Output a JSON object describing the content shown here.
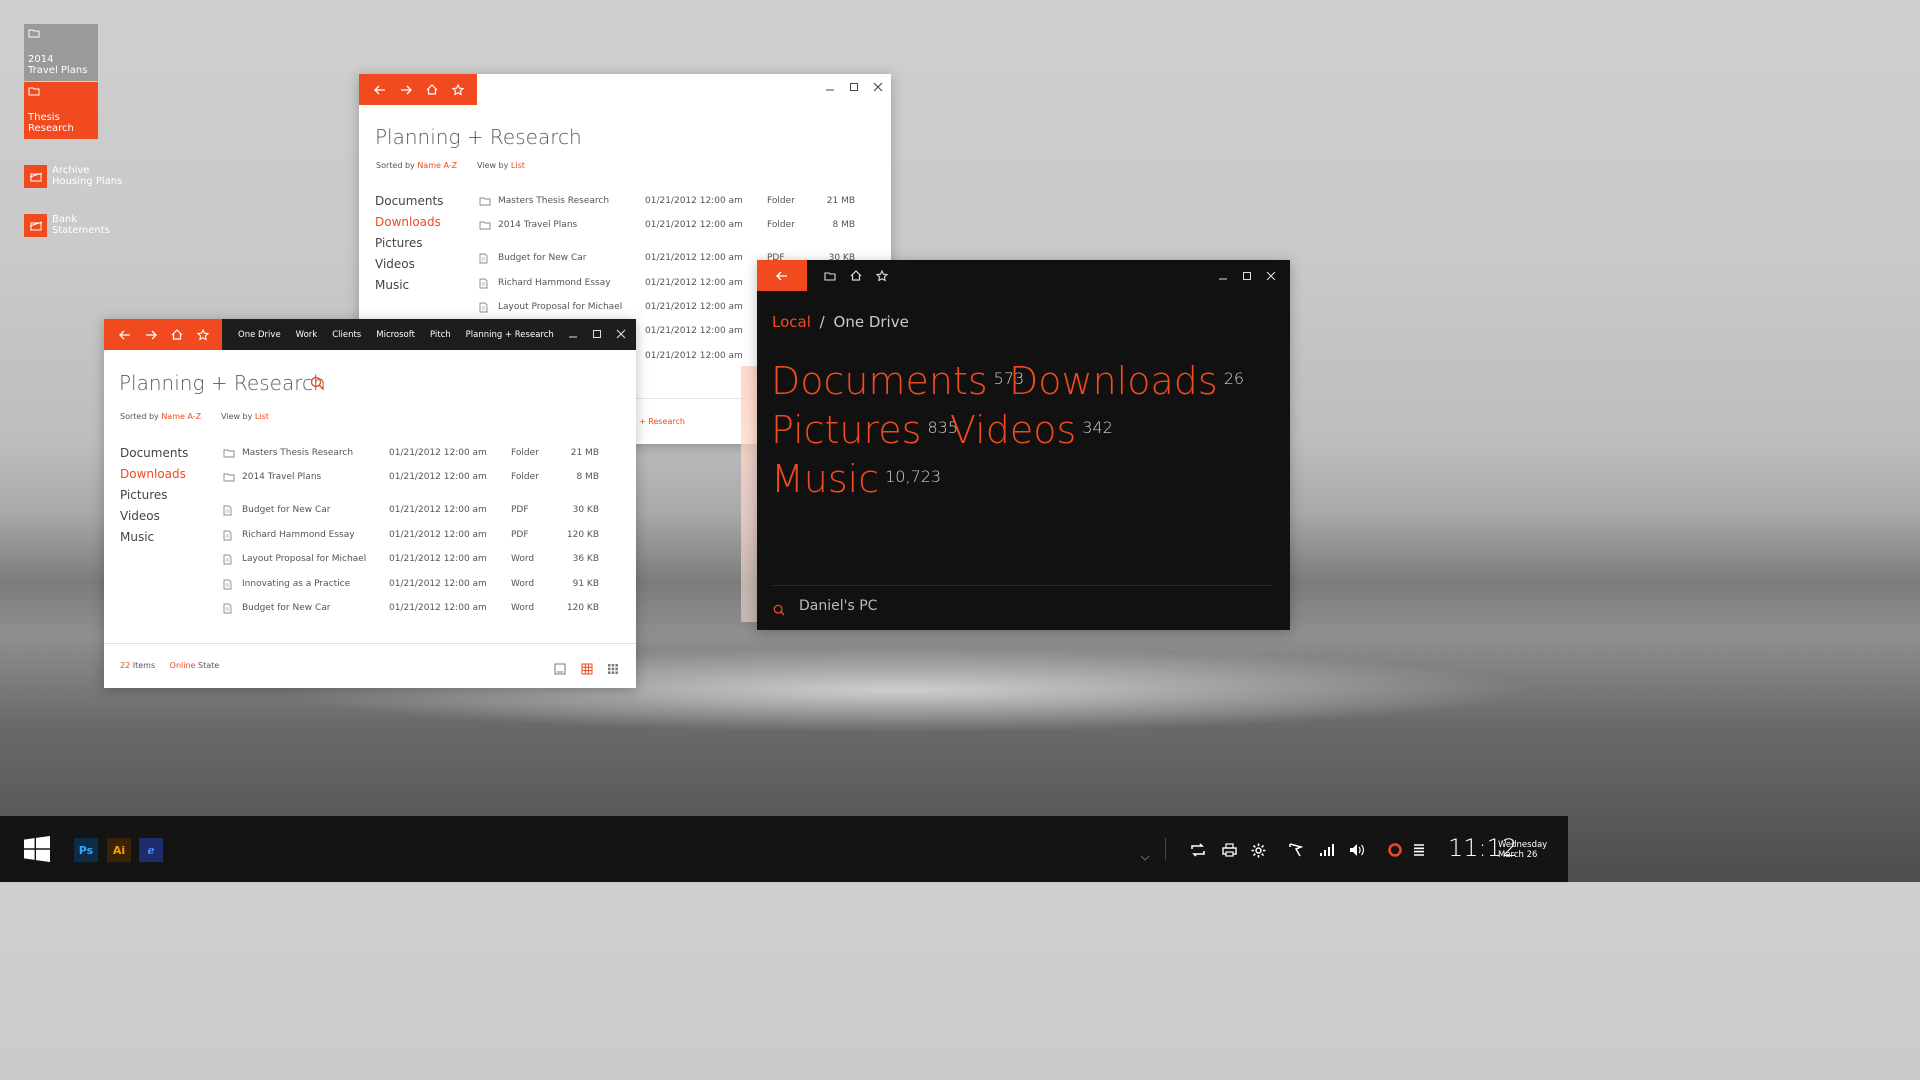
{
  "desktop": {
    "tiles": [
      {
        "line1": "2014",
        "line2": "Travel Plans",
        "color": "#9a9a9a"
      },
      {
        "line1": "Thesis",
        "line2": "Research",
        "color": "#f04a1e"
      }
    ],
    "icons": [
      {
        "line1": "Archive",
        "line2": "Housing Plans"
      },
      {
        "line1": "Bank",
        "line2": "Statements"
      }
    ]
  },
  "back_window": {
    "title": "Planning + Research",
    "sorted_label": "Sorted by",
    "sorted_value": "Name A-Z",
    "view_label": "View by",
    "view_value": "List",
    "nav": [
      "Documents",
      "Downloads",
      "Pictures",
      "Videos",
      "Music"
    ],
    "active_nav": "Downloads",
    "rows": [
      {
        "name": "Masters Thesis Research",
        "date": "01/21/2012 12:00 am",
        "type": "Folder",
        "size": "21 MB",
        "icon": "folder-icon"
      },
      {
        "name": "2014 Travel Plans",
        "date": "01/21/2012 12:00 am",
        "type": "Folder",
        "size": "8 MB",
        "icon": "folder-icon"
      },
      {
        "name": "Budget for New Car",
        "date": "01/21/2012 12:00 am",
        "type": "PDF",
        "size": "30 KB",
        "icon": "file-icon"
      },
      {
        "name": "Richard Hammond Essay",
        "date": "01/21/2012 12:00 am",
        "type": "",
        "size": "",
        "icon": "file-icon"
      },
      {
        "name": "Layout Proposal for Michael",
        "date": "01/21/2012 12:00 am",
        "type": "",
        "size": "",
        "icon": "file-icon"
      },
      {
        "name": "",
        "date": "01/21/2012 12:00 am",
        "type": "",
        "size": "",
        "icon": ""
      },
      {
        "name": "",
        "date": "01/21/2012 12:00 am",
        "type": "",
        "size": "",
        "icon": ""
      }
    ],
    "footer_link": "+ Research"
  },
  "front_window": {
    "breadcrumb": [
      "One Drive",
      "Work",
      "Clients",
      "Microsoft",
      "Pitch",
      "Planning + Research"
    ],
    "title": "Planning + Research",
    "sorted_label": "Sorted by",
    "sorted_value": "Name A-Z",
    "view_label": "View by",
    "view_value": "List",
    "nav": [
      "Documents",
      "Downloads",
      "Pictures",
      "Videos",
      "Music"
    ],
    "active_nav": "Downloads",
    "rows": [
      {
        "name": "Masters Thesis Research",
        "date": "01/21/2012 12:00 am",
        "type": "Folder",
        "size": "21 MB",
        "icon": "folder-icon"
      },
      {
        "name": "2014 Travel Plans",
        "date": "01/21/2012 12:00 am",
        "type": "Folder",
        "size": "8 MB",
        "icon": "folder-icon"
      },
      {
        "name": "Budget for New Car",
        "date": "01/21/2012 12:00 am",
        "type": "PDF",
        "size": "30 KB",
        "icon": "file-icon"
      },
      {
        "name": "Richard Hammond Essay",
        "date": "01/21/2012 12:00 am",
        "type": "PDF",
        "size": "120 KB",
        "icon": "file-icon"
      },
      {
        "name": "Layout Proposal for Michael",
        "date": "01/21/2012 12:00 am",
        "type": "Word",
        "size": "36 KB",
        "icon": "file-icon"
      },
      {
        "name": "Innovating as a Practice",
        "date": "01/21/2012 12:00 am",
        "type": "Word",
        "size": "91 KB",
        "icon": "file-icon"
      },
      {
        "name": "Budget for New Car",
        "date": "01/21/2012 12:00 am",
        "type": "Word",
        "size": "120 KB",
        "icon": "file-icon"
      }
    ],
    "status_count": "22",
    "status_items": "Items",
    "status_online": "Online",
    "status_state": "State"
  },
  "dark_window": {
    "crumb_local": "Local",
    "crumb_sep": "/",
    "crumb_current": "One Drive",
    "categories": [
      {
        "name": "Documents",
        "count": "573"
      },
      {
        "name": "Downloads",
        "count": "26"
      },
      {
        "name": "Pictures",
        "count": "835"
      },
      {
        "name": "Videos",
        "count": "342"
      },
      {
        "name": "Music",
        "count": "10,723"
      }
    ],
    "search_value": "Daniel's PC"
  },
  "taskbar": {
    "apps": [
      {
        "label": "Ps",
        "bg": "#0d2c47",
        "fg": "#31a8ff"
      },
      {
        "label": "Ai",
        "bg": "#3a2306",
        "fg": "#ff9a00"
      },
      {
        "label": "e",
        "bg": "#1d2d6b",
        "fg": "#5b8cff"
      }
    ],
    "time": "11:12",
    "day": "Wednesday",
    "date": "March 26"
  },
  "colors": {
    "accent": "#f04a1e",
    "dark_bg": "#111111",
    "taskbar": "#141414"
  }
}
